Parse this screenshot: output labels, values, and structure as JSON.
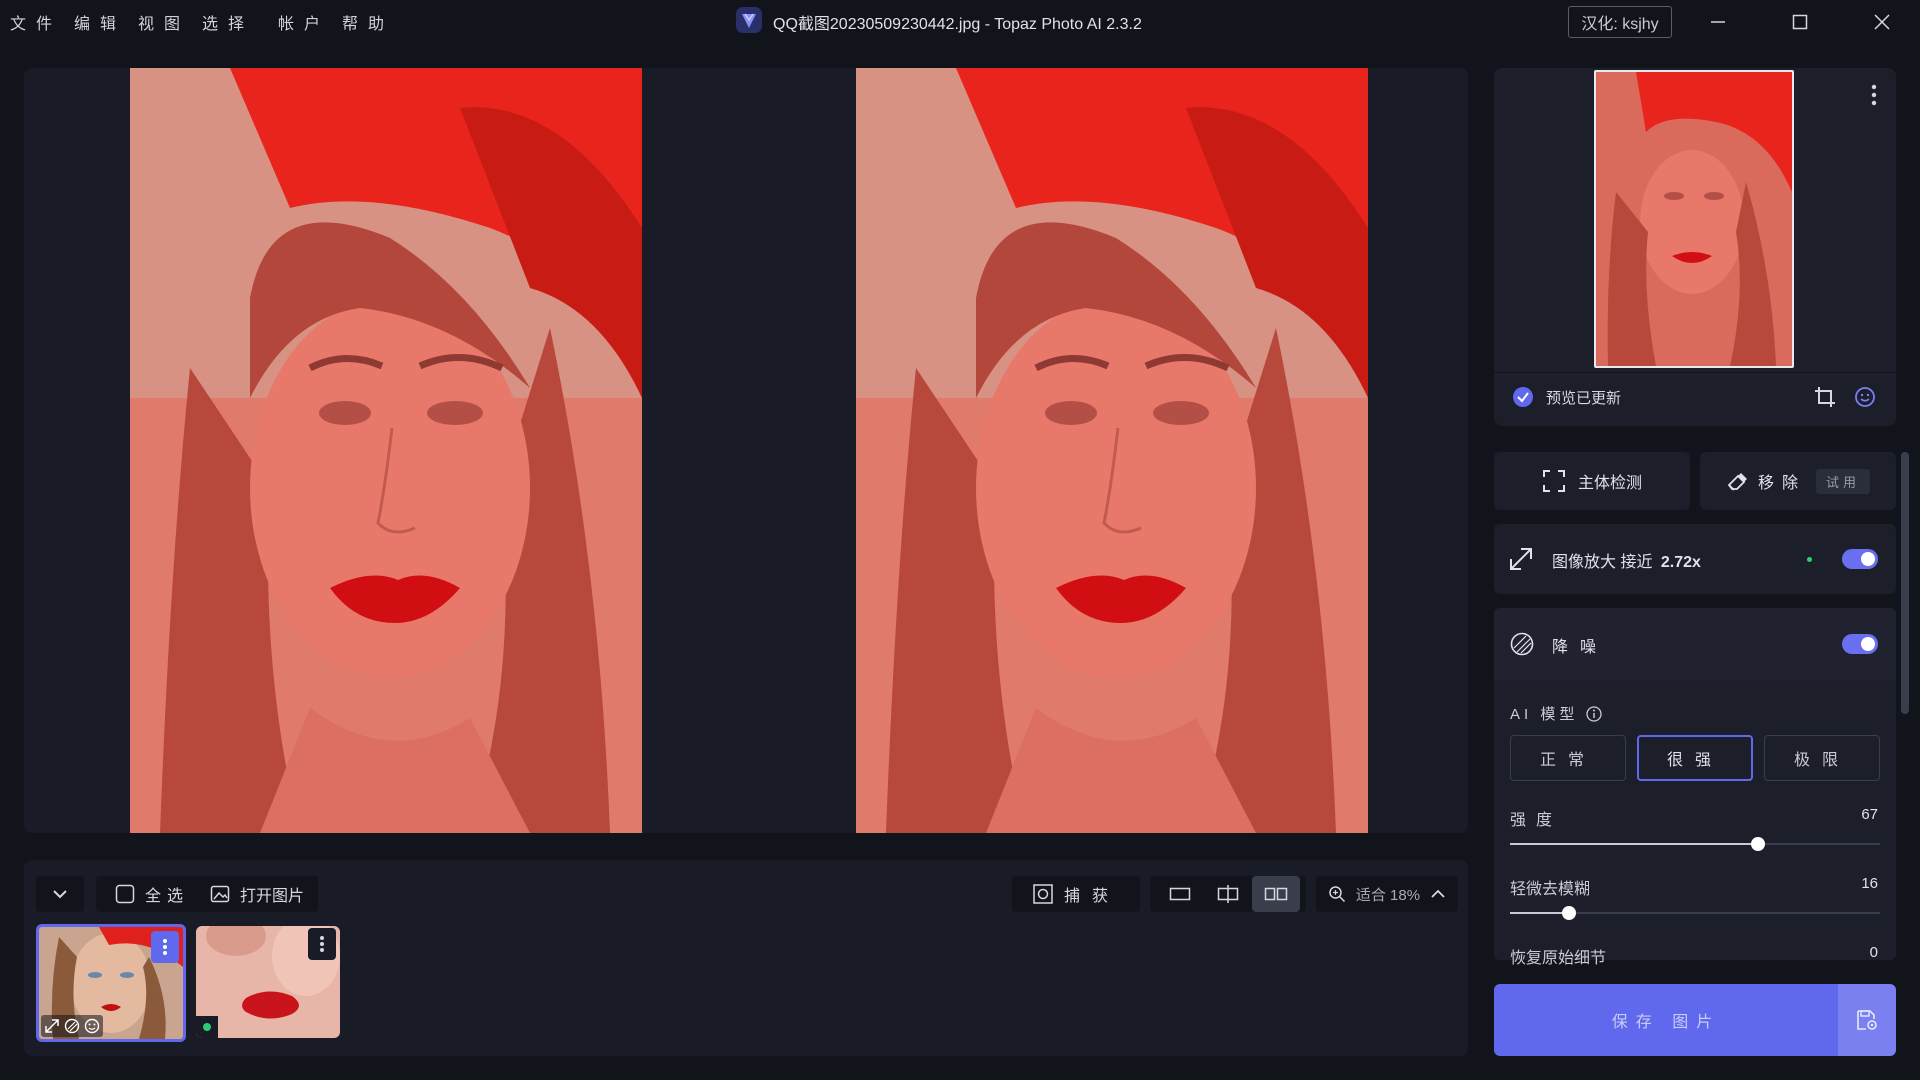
{
  "menu": [
    "文件",
    "编辑",
    "视图",
    "选择",
    "帐户",
    "帮助"
  ],
  "app_title": "QQ截图20230509230442.jpg - Topaz Photo AI 2.3.2",
  "translator_badge": "汉化: ksjhy",
  "bottom_toolbar": {
    "select_all": "全选",
    "open_image": "打开图片",
    "capture": "捕获",
    "zoom": "适合 18%"
  },
  "navigator": {
    "status": "预览已更新"
  },
  "actions": {
    "subject_detect": "主体检测",
    "remove": "移除",
    "remove_badge": "试用"
  },
  "upscale": {
    "label": "图像放大 接近",
    "value": "2.72x",
    "enabled": true
  },
  "denoise": {
    "label": "降噪",
    "enabled": true,
    "ai_model_label": "AI 模型",
    "models": [
      "正常",
      "很强",
      "极限"
    ],
    "selected_model": "很强",
    "sliders": [
      {
        "label": "强度",
        "value": 67
      },
      {
        "label": "轻微去模糊",
        "value": 16
      },
      {
        "label": "恢复原始细节",
        "value": 0
      }
    ]
  },
  "save_button": "保存 图片",
  "colors": {
    "accent": "#6068ee",
    "panel": "#1c1f2a",
    "background": "#12141c"
  }
}
